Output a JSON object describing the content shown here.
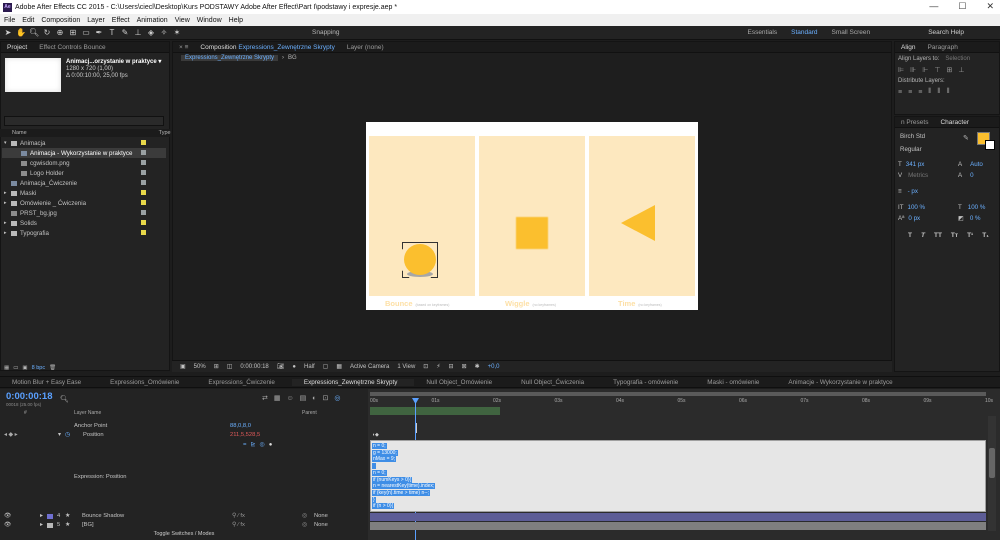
{
  "window": {
    "title": "Adobe After Effects CC 2015 - C:\\Users\\ciecl\\Desktop\\Kurs PODSTAWY Adobe After Effect\\Part I\\podstawy i expresje.aep *",
    "min": "—",
    "max": "☐",
    "close": "✕"
  },
  "menu": [
    "File",
    "Edit",
    "Composition",
    "Layer",
    "Effect",
    "Animation",
    "View",
    "Window",
    "Help"
  ],
  "toolbar": {
    "snapping": "Snapping",
    "workspaces": [
      "Essentials",
      "Standard",
      "Small Screen"
    ],
    "search_help": "Search Help"
  },
  "project": {
    "tab1": "Project",
    "tab2": "Effect Controls Bounce",
    "comp_name": "Animacj...orzystanie w praktyce ▾",
    "comp_dims": "1280 x 720 (1,00)",
    "comp_time": "Δ 0:00:10:00, 25,00 fps",
    "col_name": "Name",
    "col_type": "Type",
    "items": [
      {
        "label": "Animacja",
        "indent": 0,
        "kind": "folder",
        "color": "#e8d84a"
      },
      {
        "label": "Animacja - Wykorzystanie w praktyce",
        "indent": 1,
        "kind": "comp",
        "color": "#9aa1a3",
        "selected": true
      },
      {
        "label": "cgwisdom.png",
        "indent": 1,
        "kind": "file",
        "color": "#9aa1a3"
      },
      {
        "label": "Logo Holder",
        "indent": 1,
        "kind": "file",
        "color": "#9aa1a3"
      },
      {
        "label": "Animacja_Ćwiczenie",
        "indent": 0,
        "kind": "comp",
        "color": "#9aa1a3"
      },
      {
        "label": "Maski",
        "indent": 0,
        "kind": "folder",
        "color": "#e8d84a"
      },
      {
        "label": "Omówienie _ Ćwiczenia",
        "indent": 0,
        "kind": "folder",
        "color": "#e8d84a"
      },
      {
        "label": "PRST_bg.jpg",
        "indent": 0,
        "kind": "file",
        "color": "#9aa1a3"
      },
      {
        "label": "Solids",
        "indent": 0,
        "kind": "folder",
        "color": "#e8d84a"
      },
      {
        "label": "Typografia",
        "indent": 0,
        "kind": "folder",
        "color": "#e8d84a"
      }
    ],
    "bpc": "8 bpc"
  },
  "viewer": {
    "tab_comp_prefix": "Composition",
    "tab_comp": "Expressions_Zewnętrzne Skrypty",
    "tab_layer": "Layer (none)",
    "crumb_active": "Expressions_Zewnętrzne Skrypty",
    "crumb_bg": "BG",
    "cells": [
      {
        "label": "Bounce",
        "note": "(based on keyframes)"
      },
      {
        "label": "Wiggle",
        "note": "(no keyframes)"
      },
      {
        "label": "Time",
        "note": "(no keyframes)"
      }
    ],
    "shape_color": "#fbbf2e",
    "bottom": {
      "zoom": "50%",
      "timecode": "0:00:00:18",
      "resolution": "Half",
      "camera": "Active Camera",
      "view": "1 View",
      "exposure": "+0,0"
    }
  },
  "align": {
    "tab_align": "Align",
    "tab_paragraph": "Paragraph",
    "align_to_label": "Align Layers to:",
    "align_to_value": "Selection",
    "distribute": "Distribute Layers:"
  },
  "character": {
    "tab_presets": "n Presets",
    "tab_char": "Character",
    "font": "Birch Std",
    "style": "Regular",
    "size": "341 px",
    "leading": "Auto",
    "kerning": "Metrics",
    "tracking": "0",
    "stroke_unit": "- px",
    "vscale": "100 %",
    "hscale": "100 %",
    "baseline": "0 px",
    "tsume": "0 %",
    "styles": [
      "T",
      "T",
      "TT",
      "Tт",
      "T¹",
      "T₁"
    ]
  },
  "timeline": {
    "tabs": [
      "Motion Blur + Easy Ease",
      "Expressions_Omówienie",
      "Expressions_Ćwiczenie",
      "Expressions_Zewnętrzne Skrypty",
      "Null Object_Omówienie",
      "Null Object_Ćwiczenia",
      "Typografia - omówienie",
      "Maski - omówienie",
      "Animacje - Wykorzystanie w praktyce"
    ],
    "active_tab": 3,
    "timecode": "0:00:00:18",
    "timecode_sub": "00018 (25.00 fps)",
    "col_num": "#",
    "col_layer": "Layer Name",
    "col_parent": "Parent",
    "ruler": [
      "00s",
      "01s",
      "02s",
      "03s",
      "04s",
      "05s",
      "06s",
      "07s",
      "08s",
      "09s",
      "10s"
    ],
    "props": [
      {
        "name": "Anchor Point",
        "value": "88,0,8,0"
      },
      {
        "name": "Position",
        "value": "211,5,528,5"
      }
    ],
    "expression_label": "Expression: Position",
    "expression": [
      "n = 0;",
      "g = 13000;",
      "nMax = 9;",
      "",
      "n = 0;",
      "if (numKeys > 0){",
      "  n = nearestKey(time).index;",
      "  if (key(n).time > time) n--;",
      "}",
      "if (n > 0){"
    ],
    "layers": [
      {
        "num": "4",
        "name": "Bounce Shadow",
        "color": "#6f6fd0",
        "parent": "None"
      },
      {
        "num": "5",
        "name": "[BG]",
        "color": "#b7b7b7",
        "parent": "None"
      }
    ],
    "toggle": "Toggle Switches / Modes"
  }
}
